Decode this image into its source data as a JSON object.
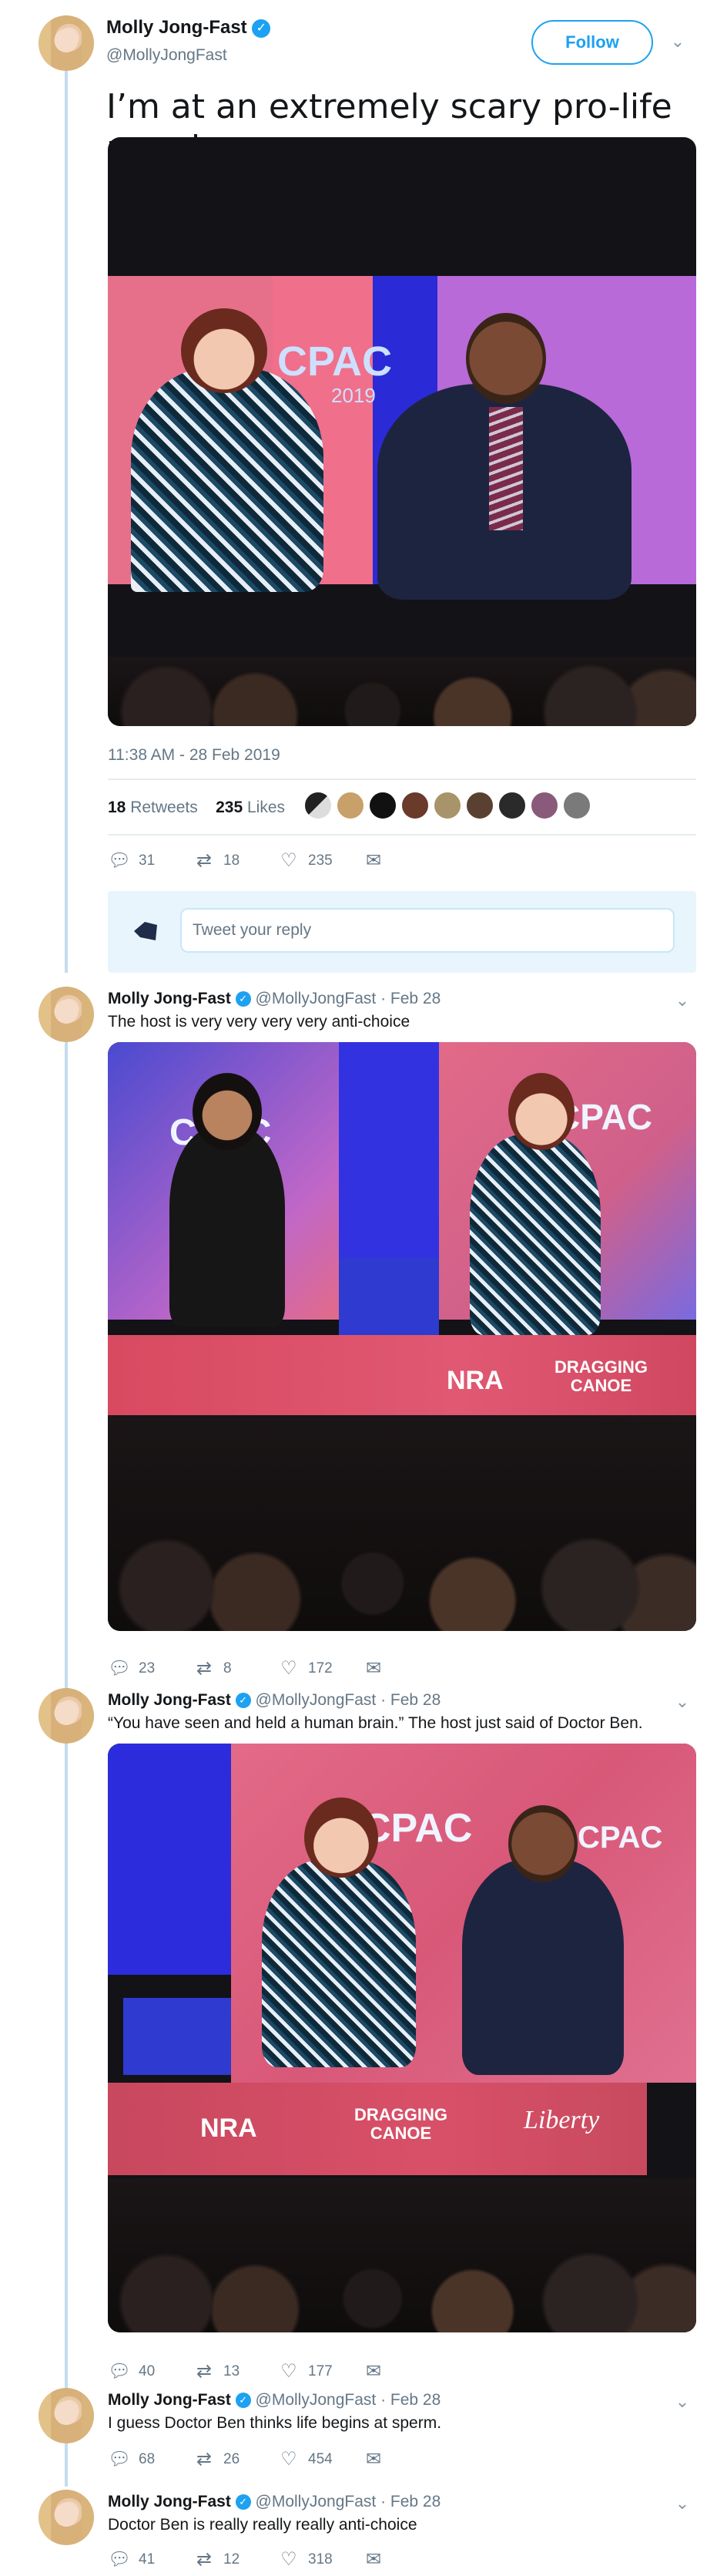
{
  "main_tweet": {
    "author_name": "Molly Jong-Fast",
    "verified_mark": "✓",
    "handle": "@MollyJongFast",
    "follow_label": "Follow",
    "text": "I’m at an extremely scary pro-life panel.",
    "timestamp": "11:38 AM - 28 Feb 2019",
    "retweets_count": "18",
    "retweets_label": "Retweets",
    "likes_count": "235",
    "likes_label": "Likes",
    "reply_count": "31",
    "retweet_count": "18",
    "like_count": "235",
    "reply_placeholder": "Tweet your reply",
    "icons": [
      "chevron-down-icon",
      "reply-icon",
      "retweet-icon",
      "heart-icon",
      "envelope-icon"
    ]
  },
  "thread": [
    {
      "author_name": "Molly Jong-Fast",
      "handle": "@MollyJongFast",
      "date": "· Feb 28",
      "text": "The host is very very very very anti-choice",
      "reply_count": "23",
      "retweet_count": "8",
      "like_count": "172"
    },
    {
      "author_name": "Molly Jong-Fast",
      "handle": "@MollyJongFast",
      "date": "· Feb 28",
      "text": "“You have seen and held a human brain.” The host just said of Doctor Ben.",
      "reply_count": "40",
      "retweet_count": "13",
      "like_count": "177"
    },
    {
      "author_name": "Molly Jong-Fast",
      "handle": "@MollyJongFast",
      "date": "· Feb 28",
      "text": "I guess Doctor Ben thinks life begins at sperm.",
      "reply_count": "68",
      "retweet_count": "26",
      "like_count": "454"
    },
    {
      "author_name": "Molly Jong-Fast",
      "handle": "@MollyJongFast",
      "date": "· Feb 28",
      "text": "Doctor Ben is really really really anti-choice",
      "reply_count": "41",
      "retweet_count": "12",
      "like_count": "318"
    }
  ],
  "colors": {
    "accent": "#1da1f2",
    "thread_line": "#c4dcee",
    "muted": "#657786",
    "reply_box_bg": "#e8f5fd",
    "stage_pink": "#e0506e",
    "stage_blue": "#2a2bd6"
  }
}
